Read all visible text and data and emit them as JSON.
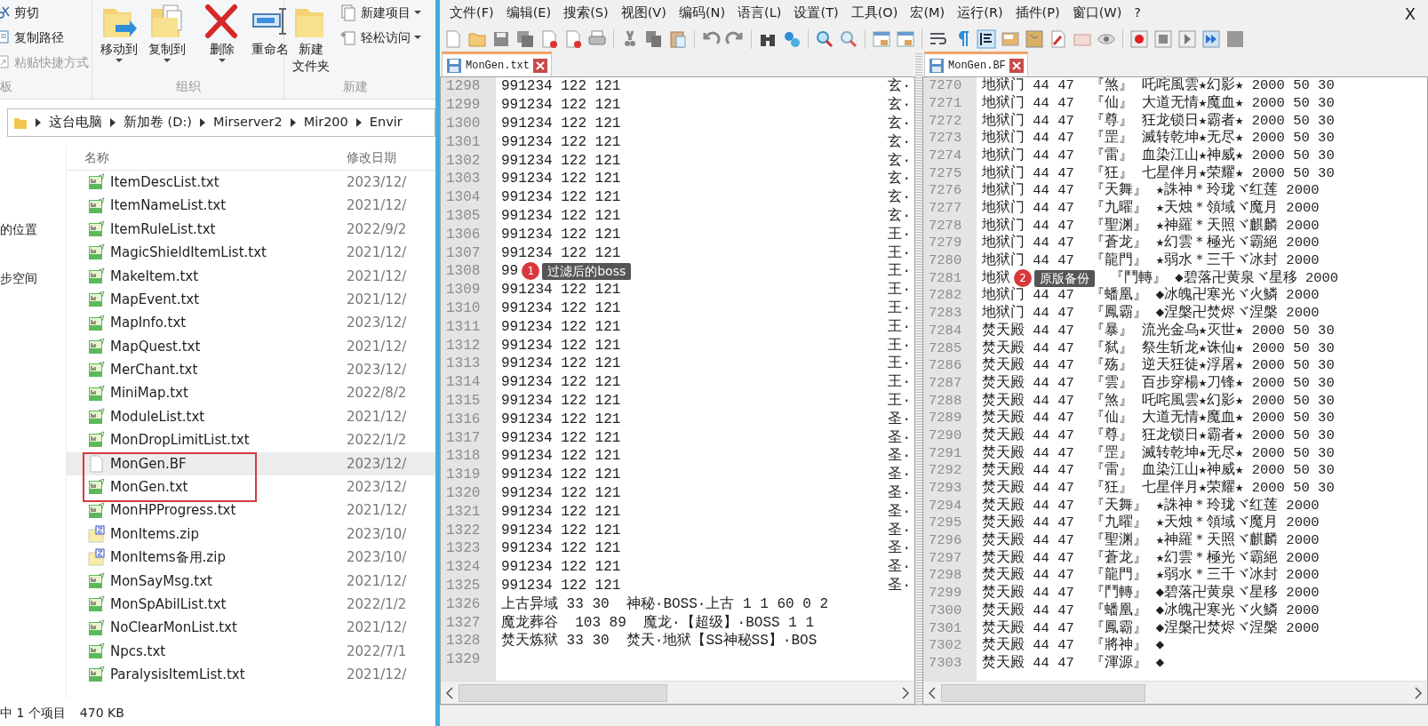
{
  "explorer": {
    "ribbon": {
      "clipboard": {
        "group_label": "板",
        "commands": [
          {
            "label": "剪切",
            "disabled": false
          },
          {
            "label": "复制路径",
            "disabled": false
          },
          {
            "label": "粘贴快捷方式",
            "disabled": true
          }
        ]
      },
      "organize": {
        "group_label": "组织",
        "commands": [
          {
            "label": "移动到",
            "dropdown": true
          },
          {
            "label": "复制到",
            "dropdown": true
          },
          {
            "label": "删除",
            "dropdown": true
          },
          {
            "label": "重命名",
            "dropdown": false
          }
        ]
      },
      "new": {
        "group_label": "新建",
        "folder_button": [
          "新建",
          "文件夹"
        ],
        "commands": [
          {
            "label": "新建项目",
            "dropdown": true
          },
          {
            "label": "轻松访问",
            "dropdown": true
          }
        ]
      }
    },
    "address": [
      "这台电脑",
      "新加卷 (D:)",
      "Mirserver2",
      "Mir200",
      "Envir"
    ],
    "nav_items": [
      {
        "label": "的位置"
      },
      {
        "label": "步空间"
      }
    ],
    "columns": [
      "名称",
      "修改日期"
    ],
    "files": [
      {
        "name": "ItemDescList.txt",
        "date": "2023/12/",
        "kind": "text",
        "selected": false,
        "boxed": false
      },
      {
        "name": "ItemNameList.txt",
        "date": "2021/12/",
        "kind": "text",
        "selected": false,
        "boxed": false
      },
      {
        "name": "ItemRuleList.txt",
        "date": "2022/9/2",
        "kind": "text",
        "selected": false,
        "boxed": false
      },
      {
        "name": "MagicShieldItemList.txt",
        "date": "2021/12/",
        "kind": "text",
        "selected": false,
        "boxed": false
      },
      {
        "name": "MakeItem.txt",
        "date": "2021/12/",
        "kind": "text",
        "selected": false,
        "boxed": false
      },
      {
        "name": "MapEvent.txt",
        "date": "2021/12/",
        "kind": "text",
        "selected": false,
        "boxed": false
      },
      {
        "name": "MapInfo.txt",
        "date": "2023/12/",
        "kind": "text",
        "selected": false,
        "boxed": false
      },
      {
        "name": "MapQuest.txt",
        "date": "2021/12/",
        "kind": "text",
        "selected": false,
        "boxed": false
      },
      {
        "name": "MerChant.txt",
        "date": "2023/12/",
        "kind": "text",
        "selected": false,
        "boxed": false
      },
      {
        "name": "MiniMap.txt",
        "date": "2022/8/2",
        "kind": "text",
        "selected": false,
        "boxed": false
      },
      {
        "name": "ModuleList.txt",
        "date": "2021/12/",
        "kind": "text",
        "selected": false,
        "boxed": false
      },
      {
        "name": "MonDropLimitList.txt",
        "date": "2022/1/2",
        "kind": "text",
        "selected": false,
        "boxed": false
      },
      {
        "name": "MonGen.BF",
        "date": "2023/12/",
        "kind": "blank",
        "selected": true,
        "boxed": true
      },
      {
        "name": "MonGen.txt",
        "date": "2023/12/",
        "kind": "text",
        "selected": false,
        "boxed": true
      },
      {
        "name": "MonHPProgress.txt",
        "date": "2021/12/",
        "kind": "text",
        "selected": false,
        "boxed": false
      },
      {
        "name": "MonItems.zip",
        "date": "2023/10/",
        "kind": "zip",
        "selected": false,
        "boxed": false
      },
      {
        "name": "MonItems备用.zip",
        "date": "2023/10/",
        "kind": "zip",
        "selected": false,
        "boxed": false
      },
      {
        "name": "MonSayMsg.txt",
        "date": "2021/12/",
        "kind": "text",
        "selected": false,
        "boxed": false
      },
      {
        "name": "MonSpAbilList.txt",
        "date": "2022/1/2",
        "kind": "text",
        "selected": false,
        "boxed": false
      },
      {
        "name": "NoClearMonList.txt",
        "date": "2021/12/",
        "kind": "text",
        "selected": false,
        "boxed": false
      },
      {
        "name": "Npcs.txt",
        "date": "2022/7/1",
        "kind": "text",
        "selected": false,
        "boxed": false
      },
      {
        "name": "ParalysisItemList.txt",
        "date": "2021/12/",
        "kind": "text",
        "selected": false,
        "boxed": false
      }
    ],
    "status": [
      "中 1 个项目",
      "470 KB"
    ]
  },
  "editor": {
    "menu": [
      "文件(F)",
      "编辑(E)",
      "搜索(S)",
      "视图(V)",
      "编码(N)",
      "语言(L)",
      "设置(T)",
      "工具(O)",
      "宏(M)",
      "运行(R)",
      "插件(P)",
      "窗口(W)",
      "?"
    ],
    "close": "X",
    "panes": [
      {
        "tab": {
          "label": "MonGen.txt",
          "selected": true
        },
        "lines": [
          {
            "number": "1298",
            "text": "991234 122 121",
            "tail": "玄·"
          },
          {
            "number": "1299",
            "text": "991234 122 121",
            "tail": "玄·"
          },
          {
            "number": "1300",
            "text": "991234 122 121",
            "tail": "玄·"
          },
          {
            "number": "1301",
            "text": "991234 122 121",
            "tail": "玄·"
          },
          {
            "number": "1302",
            "text": "991234 122 121",
            "tail": "玄·"
          },
          {
            "number": "1303",
            "text": "991234 122 121",
            "tail": "玄·"
          },
          {
            "number": "1304",
            "text": "991234 122 121",
            "tail": "玄·"
          },
          {
            "number": "1305",
            "text": "991234 122 121",
            "tail": "玄·"
          },
          {
            "number": "1306",
            "text": "991234 122 121",
            "tail": "王·"
          },
          {
            "number": "1307",
            "text": "991234 122 121",
            "tail": "王·"
          },
          {
            "number": "1308",
            "text": "99",
            "tail": "王·",
            "callout": {
              "number": "1",
              "text": "过滤后的boss"
            }
          },
          {
            "number": "1309",
            "text": "991234 122 121",
            "tail": "王·"
          },
          {
            "number": "1310",
            "text": "991234 122 121",
            "tail": "王·"
          },
          {
            "number": "1311",
            "text": "991234 122 121",
            "tail": "王·"
          },
          {
            "number": "1312",
            "text": "991234 122 121",
            "tail": "王·"
          },
          {
            "number": "1313",
            "text": "991234 122 121",
            "tail": "王·"
          },
          {
            "number": "1314",
            "text": "991234 122 121",
            "tail": "王·"
          },
          {
            "number": "1315",
            "text": "991234 122 121",
            "tail": "王·"
          },
          {
            "number": "1316",
            "text": "991234 122 121",
            "tail": "圣·"
          },
          {
            "number": "1317",
            "text": "991234 122 121",
            "tail": "圣·"
          },
          {
            "number": "1318",
            "text": "991234 122 121",
            "tail": "圣·"
          },
          {
            "number": "1319",
            "text": "991234 122 121",
            "tail": "圣·"
          },
          {
            "number": "1320",
            "text": "991234 122 121",
            "tail": "圣·"
          },
          {
            "number": "1321",
            "text": "991234 122 121",
            "tail": "圣·"
          },
          {
            "number": "1322",
            "text": "991234 122 121",
            "tail": "圣·"
          },
          {
            "number": "1323",
            "text": "991234 122 121",
            "tail": "圣·"
          },
          {
            "number": "1324",
            "text": "991234 122 121",
            "tail": "圣·"
          },
          {
            "number": "1325",
            "text": "991234 122 121",
            "tail": "圣·"
          },
          {
            "number": "1326",
            "text": "上古异域 33 30  神秘·BOSS·上古 1 1 60 0 2"
          },
          {
            "number": "1327",
            "text": "魔龙葬谷  103 89  魔龙·【超级】·BOSS 1 1"
          },
          {
            "number": "1328",
            "text": "焚天炼狱 33 30  焚天·地狱【SS神秘SS】·BOS"
          },
          {
            "number": "1329"
          }
        ]
      },
      {
        "tab": {
          "label": "MonGen.BF",
          "selected": true
        },
        "lines": [
          {
            "number": "7270",
            "text": "地狱门 44 47  『煞』 吒咤風雲★幻影★ 2000 50 30"
          },
          {
            "number": "7271",
            "text": "地狱门 44 47  『仙』 大道无情★魔血★ 2000 50 30"
          },
          {
            "number": "7272",
            "text": "地狱门 44 47  『尊』 狂龙锁日★霸者★ 2000 50 30"
          },
          {
            "number": "7273",
            "text": "地狱门 44 47  『罡』 滅转乾坤★无尽★ 2000 50 30"
          },
          {
            "number": "7274",
            "text": "地狱门 44 47  『雷』 血染江山★神威★ 2000 50 30"
          },
          {
            "number": "7275",
            "text": "地狱门 44 47  『狂』 七星伴月★荣耀★ 2000 50 30"
          },
          {
            "number": "7276",
            "text": "地狱门 44 47  『天舞』 ★誅神＊玲珑ヾ红莲 2000"
          },
          {
            "number": "7277",
            "text": "地狱门 44 47  『九曜』 ★天烛＊領域ヾ魔月 2000"
          },
          {
            "number": "7278",
            "text": "地狱门 44 47  『聖渊』 ★神羅＊天照ヾ麒麟 2000"
          },
          {
            "number": "7279",
            "text": "地狱门 44 47  『蒼龙』 ★幻雲＊極光ヾ霸絕 2000"
          },
          {
            "number": "7280",
            "text": "地狱门 44 47  『龍門』 ★弱水＊三千ヾ冰封 2000"
          },
          {
            "number": "7281",
            "text": "地狱",
            "callout": {
              "number": "2",
              "text": "原版备份"
            },
            "rest": "『鬥轉』 ◆碧落卍黄泉ヾ星移 2000"
          },
          {
            "number": "7282",
            "text": "地狱门 44 47  『蟠凰』 ◆冰魄卍寒光ヾ火鱗 2000"
          },
          {
            "number": "7283",
            "text": "地狱门 44 47  『鳳霸』 ◆涅槃卍焚烬ヾ涅槃 2000"
          },
          {
            "number": "7284",
            "text": "焚天殿 44 47  『暴』 流光金乌★灭世★ 2000 50 30"
          },
          {
            "number": "7285",
            "text": "焚天殿 44 47  『弑』 祭生斩龙★诛仙★ 2000 50 30"
          },
          {
            "number": "7286",
            "text": "焚天殿 44 47  『殇』 逆天狂徒★浮屠★ 2000 50 30"
          },
          {
            "number": "7287",
            "text": "焚天殿 44 47  『雲』 百步穿楊★刀锋★ 2000 50 30"
          },
          {
            "number": "7288",
            "text": "焚天殿 44 47  『煞』 吒咤風雲★幻影★ 2000 50 30"
          },
          {
            "number": "7289",
            "text": "焚天殿 44 47  『仙』 大道无情★魔血★ 2000 50 30"
          },
          {
            "number": "7290",
            "text": "焚天殿 44 47  『尊』 狂龙锁日★霸者★ 2000 50 30"
          },
          {
            "number": "7291",
            "text": "焚天殿 44 47  『罡』 滅转乾坤★无尽★ 2000 50 30"
          },
          {
            "number": "7292",
            "text": "焚天殿 44 47  『雷』 血染江山★神威★ 2000 50 30"
          },
          {
            "number": "7293",
            "text": "焚天殿 44 47  『狂』 七星伴月★荣耀★ 2000 50 30"
          },
          {
            "number": "7294",
            "text": "焚天殿 44 47  『天舞』 ★誅神＊玲珑ヾ红莲 2000"
          },
          {
            "number": "7295",
            "text": "焚天殿 44 47  『九曜』 ★天烛＊領域ヾ魔月 2000"
          },
          {
            "number": "7296",
            "text": "焚天殿 44 47  『聖渊』 ★神羅＊天照ヾ麒麟 2000"
          },
          {
            "number": "7297",
            "text": "焚天殿 44 47  『蒼龙』 ★幻雲＊極光ヾ霸絕 2000"
          },
          {
            "number": "7298",
            "text": "焚天殿 44 47  『龍門』 ★弱水＊三千ヾ冰封 2000"
          },
          {
            "number": "7299",
            "text": "焚天殿 44 47  『鬥轉』 ◆碧落卍黄泉ヾ星移 2000"
          },
          {
            "number": "7300",
            "text": "焚天殿 44 47  『蟠凰』 ◆冰魄卍寒光ヾ火鱗 2000"
          },
          {
            "number": "7301",
            "text": "焚天殿 44 47  『鳳霸』 ◆涅槃卍焚烬ヾ涅槃 2000"
          },
          {
            "number": "7302",
            "text": "焚天殿 44 47  『將神』 ◆"
          },
          {
            "number": "7303",
            "text": "焚天殿 44 47  『渾源』 ◆"
          }
        ]
      }
    ]
  }
}
